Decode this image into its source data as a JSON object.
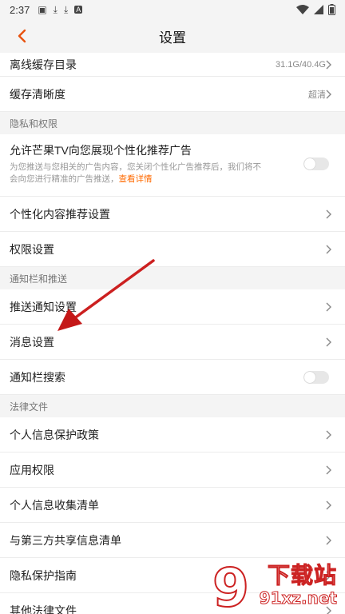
{
  "status_bar": {
    "time": "2:37",
    "icons": [
      "photo-icon",
      "download-icon",
      "download-icon",
      "a-icon"
    ],
    "right_icons": [
      "wifi-icon",
      "signal-icon",
      "battery-icon"
    ]
  },
  "header": {
    "title": "设置",
    "back_icon": "chevron-left-icon",
    "accent": "#e8520f"
  },
  "rows_top": [
    {
      "label": "离线缓存目录",
      "value": "31.1G/40.4G"
    },
    {
      "label": "缓存清晰度",
      "value": "超清"
    }
  ],
  "section_privacy": "隐私和权限",
  "ad_setting": {
    "title": "允许芒果TV向您展现个性化推荐广告",
    "desc_line1": "为您推送与您相关的广告内容，您关闭个性化广告推荐后，我们将不",
    "desc_line2": "会向您进行精准的广告推送，",
    "link": "查看详情",
    "enabled": false
  },
  "rows_privacy": [
    {
      "label": "个性化内容推荐设置"
    },
    {
      "label": "权限设置"
    }
  ],
  "section_notify": "通知栏和推送",
  "rows_notify": [
    {
      "label": "推送通知设置"
    },
    {
      "label": "消息设置"
    }
  ],
  "notify_search": {
    "label": "通知栏搜索",
    "enabled": false
  },
  "section_legal": "法律文件",
  "rows_legal": [
    {
      "label": "个人信息保护政策"
    },
    {
      "label": "应用权限"
    },
    {
      "label": "个人信息收集清单"
    },
    {
      "label": "与第三方共享信息清单"
    },
    {
      "label": "隐私保护指南"
    },
    {
      "label": "其他法律文件"
    }
  ],
  "watermark": {
    "brand": "下载站",
    "url": "91xz.net",
    "mark": "9"
  },
  "colors": {
    "link": "#ff6a00",
    "arrow": "#d42020",
    "section_bg": "#f4f4f4"
  }
}
